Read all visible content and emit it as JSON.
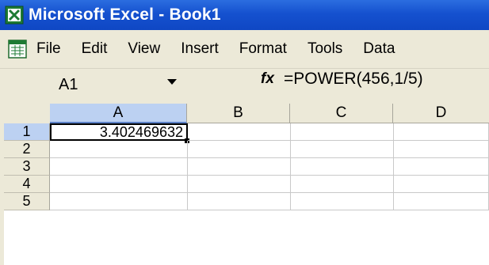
{
  "window": {
    "title": "Microsoft Excel - Book1",
    "app_icon": "excel-icon"
  },
  "menu": {
    "doc_icon": "workbook-icon",
    "items": [
      "File",
      "Edit",
      "View",
      "Insert",
      "Format",
      "Tools",
      "Data"
    ]
  },
  "formula_bar": {
    "name_box": "A1",
    "fx_label": "fx",
    "formula": "=POWER(456,1/5)"
  },
  "sheet": {
    "columns": [
      "A",
      "B",
      "C",
      "D"
    ],
    "rows": [
      "1",
      "2",
      "3",
      "4",
      "5"
    ],
    "selected_column": "A",
    "selected_row": "1",
    "cells": {
      "A1": "3.402469632"
    }
  },
  "colors": {
    "titlebar": "#0f47c4",
    "chrome": "#ece9d8",
    "selection_header": "#bcd1f2"
  }
}
